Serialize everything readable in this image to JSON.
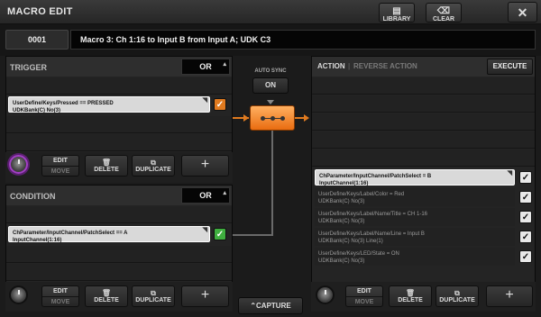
{
  "window": {
    "title": "MACRO EDIT",
    "library_label": "LIBRARY",
    "clear_label": "CLEAR",
    "close_glyph": "✕"
  },
  "macro": {
    "number": "0001",
    "name": "Macro 3: Ch 1:16 to Input B from Input A; UDK C3"
  },
  "trigger": {
    "label": "TRIGGER",
    "logic": "OR",
    "entries": [
      {
        "line1": "UserDefine/Keys/Pressed == PRESSED",
        "line2": "UDKBank(C) No(3)",
        "checked": true
      }
    ]
  },
  "condition": {
    "label": "CONDITION",
    "logic": "OR",
    "entries": [
      {
        "line1": "ChParameter/InputChannel/PatchSelect == A",
        "line2": "InputChannel(1:16)",
        "checked": true
      }
    ]
  },
  "buttons": {
    "edit": "EDIT",
    "move": "MOVE",
    "delete": "DELETE",
    "duplicate": "DUPLICATE",
    "add": "+"
  },
  "autosync": {
    "label": "AUTO SYNC",
    "state": "ON"
  },
  "capture_label": "CAPTURE",
  "action": {
    "tab_action": "ACTION",
    "tab_reverse": "REVERSE ACTION",
    "execute_label": "EXECUTE",
    "entries": [
      {
        "line1": "ChParameter/InputChannel/PatchSelect = B",
        "line2": "InputChannel(1:16)",
        "checked": true
      },
      {
        "line1": "UserDefine/Keys/Label/Color = Red",
        "line2": "UDKBank(C) No(3)",
        "checked": true
      },
      {
        "line1": "UserDefine/Keys/Label/Name/Title = CH 1-16",
        "line2": "UDKBank(C) No(3)",
        "checked": true
      },
      {
        "line1": "UserDefine/Keys/Label/Name/Line = Input B",
        "line2": "UDKBank(C) No(3) Line(1)",
        "checked": true
      },
      {
        "line1": "UserDefine/Keys/LED/State = ON",
        "line2": "UDKBank(C) No(3)",
        "checked": true
      }
    ]
  },
  "colors": {
    "accent": "#e07a1f",
    "check_green": "#3fae3f",
    "knob_highlight": "#a23ec5"
  }
}
